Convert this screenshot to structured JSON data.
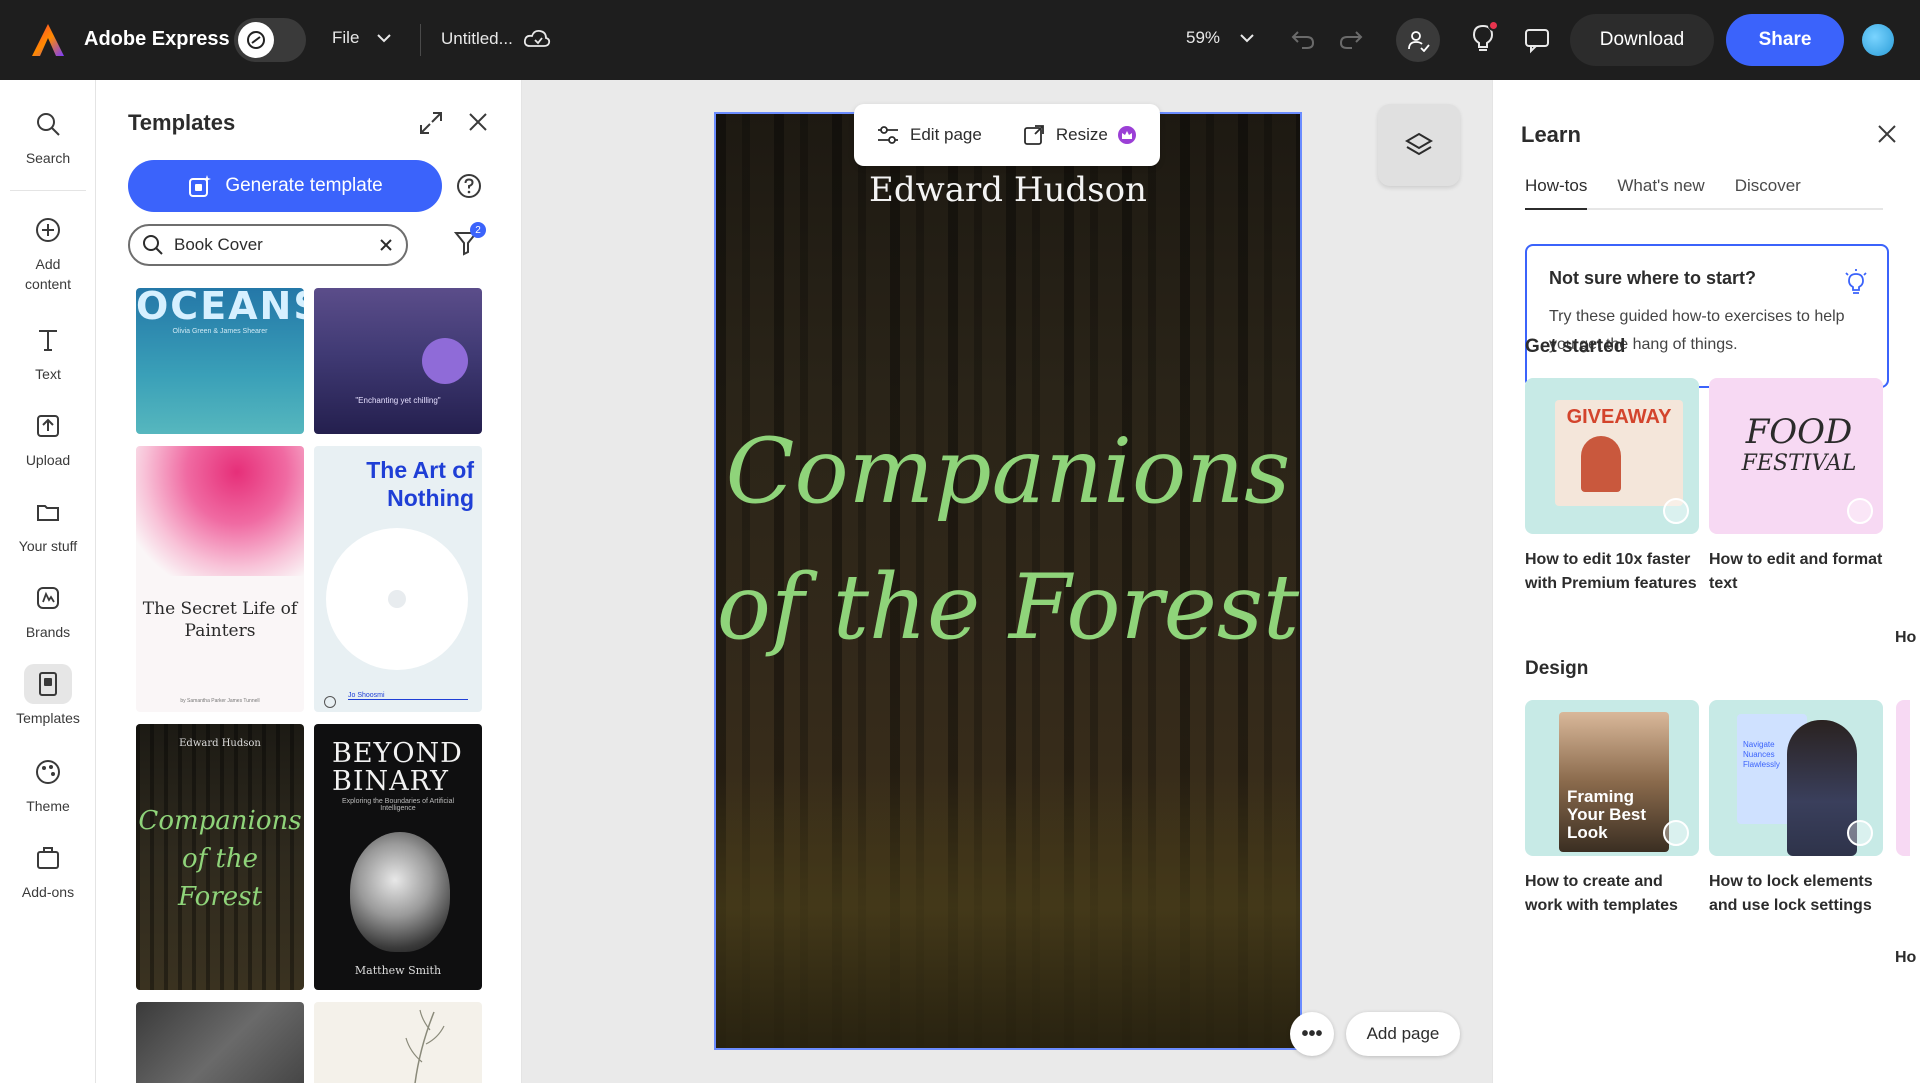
{
  "app": {
    "name": "Adobe Express",
    "file_menu": "File",
    "doc_title": "Untitled...",
    "zoom": "59%"
  },
  "toolbar": {
    "download_label": "Download",
    "share_label": "Share"
  },
  "rail": {
    "items": [
      {
        "label": "Search"
      },
      {
        "label": "Add content"
      },
      {
        "label": "Text"
      },
      {
        "label": "Upload"
      },
      {
        "label": "Your stuff"
      },
      {
        "label": "Brands"
      },
      {
        "label": "Templates"
      },
      {
        "label": "Theme"
      },
      {
        "label": "Add-ons"
      }
    ],
    "active": "Templates"
  },
  "templates_panel": {
    "title": "Templates",
    "generate_label": "Generate template",
    "search_value": "Book Cover",
    "filter_count": "2",
    "cards": [
      {
        "title": "OCEANS",
        "subtitle": "Olivia Green & James Shearer"
      },
      {
        "quote": "\"Enchanting yet chilling\""
      },
      {
        "title": "The Secret Life of Painters",
        "footer": "by Samantha Parker James Tunnell"
      },
      {
        "title": "The Art of Nothing",
        "author": "Jo Shoosmi"
      },
      {
        "author": "Edward Hudson",
        "title": "Companions of the Forest"
      },
      {
        "title": "BEYOND BINARY",
        "subtitle": "Exploring the Boundaries of Artificial Intelligence",
        "author": "Matthew Smith"
      }
    ]
  },
  "canvas": {
    "author": "Edward Hudson",
    "title_line1": "Companions",
    "title_line2": "of the Forest",
    "edit_page_label": "Edit page",
    "resize_label": "Resize",
    "more_label": "•••",
    "add_page_label": "Add page"
  },
  "learn": {
    "title": "Learn",
    "tabs": [
      "How-tos",
      "What's new",
      "Discover"
    ],
    "active_tab": "How-tos",
    "tip": {
      "title": "Not sure where to start?",
      "body": "Try these guided how-to exercises to help you get the hang of things."
    },
    "sections": [
      {
        "title": "Get started",
        "cards": [
          {
            "label": "How to edit 10x faster with Premium features",
            "thumb_text": "GIVEAWAY"
          },
          {
            "label": "How to edit and format text",
            "thumb_text": "FOOD",
            "thumb_text2": "FESTIVAL"
          }
        ],
        "peek": "Ho pl"
      },
      {
        "title": "Design",
        "cards": [
          {
            "label": "How to create and work with templates",
            "thumb_text": "Framing Your Best Look"
          },
          {
            "label": "How to lock elements and use lock settings",
            "thumb_text": "Navigate Nuances Flawlessly"
          }
        ],
        "peek": "Ho ar pl"
      }
    ]
  },
  "colors": {
    "accent": "#3b63fb",
    "topbar": "#1e1e1e",
    "title_green": "#8fd47a",
    "notification": "#e8344e"
  }
}
